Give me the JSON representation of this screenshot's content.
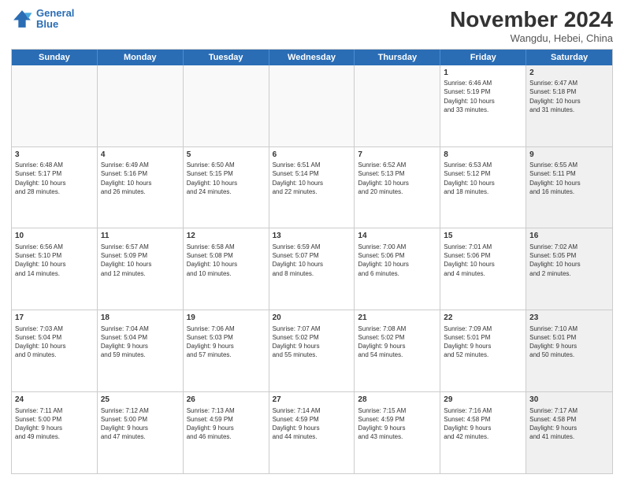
{
  "logo": {
    "line1": "General",
    "line2": "Blue"
  },
  "title": "November 2024",
  "location": "Wangdu, Hebei, China",
  "days_of_week": [
    "Sunday",
    "Monday",
    "Tuesday",
    "Wednesday",
    "Thursday",
    "Friday",
    "Saturday"
  ],
  "weeks": [
    [
      {
        "day": "",
        "info": "",
        "empty": true
      },
      {
        "day": "",
        "info": "",
        "empty": true
      },
      {
        "day": "",
        "info": "",
        "empty": true
      },
      {
        "day": "",
        "info": "",
        "empty": true
      },
      {
        "day": "",
        "info": "",
        "empty": true
      },
      {
        "day": "1",
        "info": "Sunrise: 6:46 AM\nSunset: 5:19 PM\nDaylight: 10 hours\nand 33 minutes.",
        "empty": false
      },
      {
        "day": "2",
        "info": "Sunrise: 6:47 AM\nSunset: 5:18 PM\nDaylight: 10 hours\nand 31 minutes.",
        "empty": false,
        "shaded": true
      }
    ],
    [
      {
        "day": "3",
        "info": "Sunrise: 6:48 AM\nSunset: 5:17 PM\nDaylight: 10 hours\nand 28 minutes.",
        "empty": false
      },
      {
        "day": "4",
        "info": "Sunrise: 6:49 AM\nSunset: 5:16 PM\nDaylight: 10 hours\nand 26 minutes.",
        "empty": false
      },
      {
        "day": "5",
        "info": "Sunrise: 6:50 AM\nSunset: 5:15 PM\nDaylight: 10 hours\nand 24 minutes.",
        "empty": false
      },
      {
        "day": "6",
        "info": "Sunrise: 6:51 AM\nSunset: 5:14 PM\nDaylight: 10 hours\nand 22 minutes.",
        "empty": false
      },
      {
        "day": "7",
        "info": "Sunrise: 6:52 AM\nSunset: 5:13 PM\nDaylight: 10 hours\nand 20 minutes.",
        "empty": false
      },
      {
        "day": "8",
        "info": "Sunrise: 6:53 AM\nSunset: 5:12 PM\nDaylight: 10 hours\nand 18 minutes.",
        "empty": false
      },
      {
        "day": "9",
        "info": "Sunrise: 6:55 AM\nSunset: 5:11 PM\nDaylight: 10 hours\nand 16 minutes.",
        "empty": false,
        "shaded": true
      }
    ],
    [
      {
        "day": "10",
        "info": "Sunrise: 6:56 AM\nSunset: 5:10 PM\nDaylight: 10 hours\nand 14 minutes.",
        "empty": false
      },
      {
        "day": "11",
        "info": "Sunrise: 6:57 AM\nSunset: 5:09 PM\nDaylight: 10 hours\nand 12 minutes.",
        "empty": false
      },
      {
        "day": "12",
        "info": "Sunrise: 6:58 AM\nSunset: 5:08 PM\nDaylight: 10 hours\nand 10 minutes.",
        "empty": false
      },
      {
        "day": "13",
        "info": "Sunrise: 6:59 AM\nSunset: 5:07 PM\nDaylight: 10 hours\nand 8 minutes.",
        "empty": false
      },
      {
        "day": "14",
        "info": "Sunrise: 7:00 AM\nSunset: 5:06 PM\nDaylight: 10 hours\nand 6 minutes.",
        "empty": false
      },
      {
        "day": "15",
        "info": "Sunrise: 7:01 AM\nSunset: 5:06 PM\nDaylight: 10 hours\nand 4 minutes.",
        "empty": false
      },
      {
        "day": "16",
        "info": "Sunrise: 7:02 AM\nSunset: 5:05 PM\nDaylight: 10 hours\nand 2 minutes.",
        "empty": false,
        "shaded": true
      }
    ],
    [
      {
        "day": "17",
        "info": "Sunrise: 7:03 AM\nSunset: 5:04 PM\nDaylight: 10 hours\nand 0 minutes.",
        "empty": false
      },
      {
        "day": "18",
        "info": "Sunrise: 7:04 AM\nSunset: 5:04 PM\nDaylight: 9 hours\nand 59 minutes.",
        "empty": false
      },
      {
        "day": "19",
        "info": "Sunrise: 7:06 AM\nSunset: 5:03 PM\nDaylight: 9 hours\nand 57 minutes.",
        "empty": false
      },
      {
        "day": "20",
        "info": "Sunrise: 7:07 AM\nSunset: 5:02 PM\nDaylight: 9 hours\nand 55 minutes.",
        "empty": false
      },
      {
        "day": "21",
        "info": "Sunrise: 7:08 AM\nSunset: 5:02 PM\nDaylight: 9 hours\nand 54 minutes.",
        "empty": false
      },
      {
        "day": "22",
        "info": "Sunrise: 7:09 AM\nSunset: 5:01 PM\nDaylight: 9 hours\nand 52 minutes.",
        "empty": false
      },
      {
        "day": "23",
        "info": "Sunrise: 7:10 AM\nSunset: 5:01 PM\nDaylight: 9 hours\nand 50 minutes.",
        "empty": false,
        "shaded": true
      }
    ],
    [
      {
        "day": "24",
        "info": "Sunrise: 7:11 AM\nSunset: 5:00 PM\nDaylight: 9 hours\nand 49 minutes.",
        "empty": false
      },
      {
        "day": "25",
        "info": "Sunrise: 7:12 AM\nSunset: 5:00 PM\nDaylight: 9 hours\nand 47 minutes.",
        "empty": false
      },
      {
        "day": "26",
        "info": "Sunrise: 7:13 AM\nSunset: 4:59 PM\nDaylight: 9 hours\nand 46 minutes.",
        "empty": false
      },
      {
        "day": "27",
        "info": "Sunrise: 7:14 AM\nSunset: 4:59 PM\nDaylight: 9 hours\nand 44 minutes.",
        "empty": false
      },
      {
        "day": "28",
        "info": "Sunrise: 7:15 AM\nSunset: 4:59 PM\nDaylight: 9 hours\nand 43 minutes.",
        "empty": false
      },
      {
        "day": "29",
        "info": "Sunrise: 7:16 AM\nSunset: 4:58 PM\nDaylight: 9 hours\nand 42 minutes.",
        "empty": false
      },
      {
        "day": "30",
        "info": "Sunrise: 7:17 AM\nSunset: 4:58 PM\nDaylight: 9 hours\nand 41 minutes.",
        "empty": false,
        "shaded": true
      }
    ]
  ]
}
